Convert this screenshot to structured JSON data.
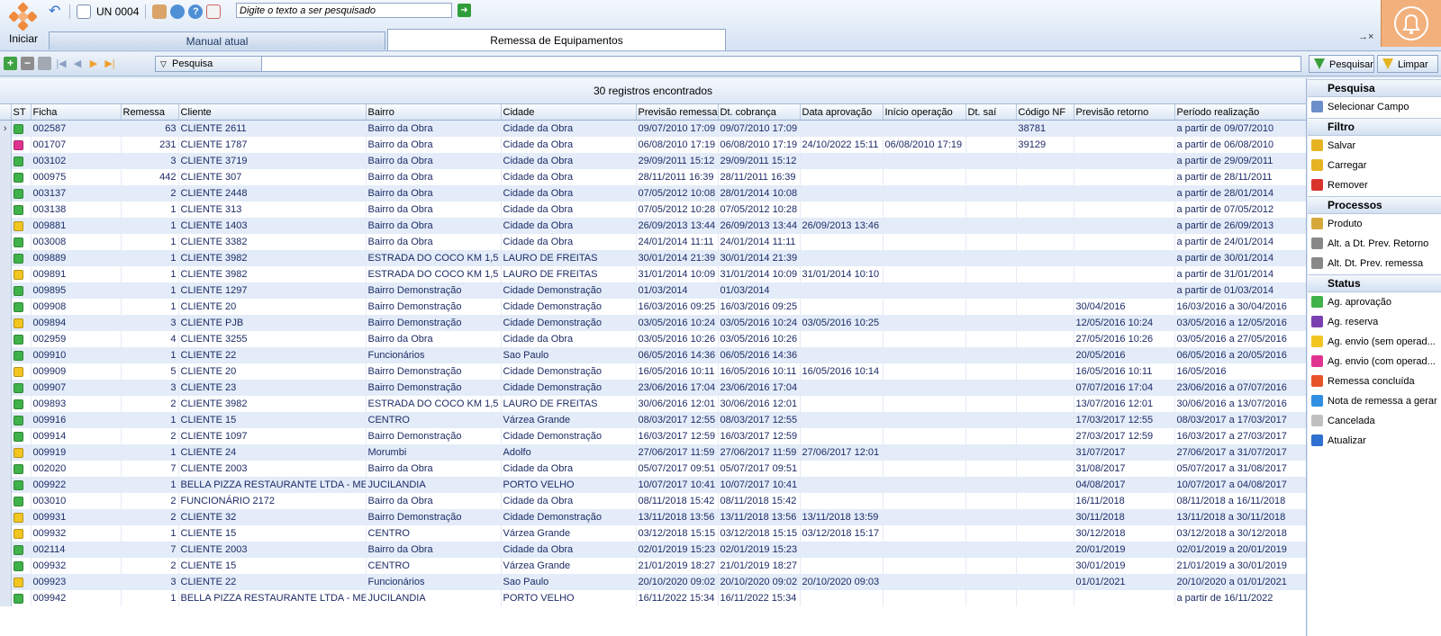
{
  "toolbar": {
    "start_label": "Iniciar",
    "unit": "UN 0004",
    "search_placeholder": "Digite o texto a ser pesquisado"
  },
  "tabs": [
    {
      "label": "Manual atual"
    },
    {
      "label": "Remessa de Equipamentos"
    }
  ],
  "tab_close": "→×",
  "filterbar": {
    "pesquisa_label": "Pesquisa",
    "search_button": "Pesquisar",
    "clear_button": "Limpar"
  },
  "grid": {
    "record_count": "30 registros encontrados",
    "columns": [
      "ST",
      "Ficha",
      "Remessa",
      "Cliente",
      "Bairro",
      "Cidade",
      "Previsão remessa",
      "Dt. cobrança",
      "Data aprovação",
      "Início operação",
      "Dt. saí",
      "Código NF",
      "Previsão retorno",
      "Período realização"
    ],
    "status_colors": {
      "green": "#3fb24a",
      "yellow": "#f2c521",
      "magenta": "#e0338f"
    },
    "rows": [
      [
        "green",
        "002587",
        "63",
        "CLIENTE  2611",
        "Bairro da Obra",
        "Cidade da Obra",
        "09/07/2010 17:09",
        "09/07/2010 17:09",
        "",
        "",
        "",
        "38781",
        "",
        "a partir de 09/07/2010"
      ],
      [
        "magenta",
        "001707",
        "231",
        "CLIENTE  1787",
        "Bairro da Obra",
        "Cidade da Obra",
        "06/08/2010 17:19",
        "06/08/2010 17:19",
        "24/10/2022 15:11",
        "06/08/2010 17:19",
        "",
        "39129",
        "",
        "a partir de 06/08/2010"
      ],
      [
        "green",
        "003102",
        "3",
        "CLIENTE  3719",
        "Bairro da Obra",
        "Cidade da Obra",
        "29/09/2011 15:12",
        "29/09/2011 15:12",
        "",
        "",
        "",
        "",
        "",
        "a partir de 29/09/2011"
      ],
      [
        "green",
        "000975",
        "442",
        "CLIENTE  307",
        "Bairro da Obra",
        "Cidade da Obra",
        "28/11/2011 16:39",
        "28/11/2011 16:39",
        "",
        "",
        "",
        "",
        "",
        "a partir de 28/11/2011"
      ],
      [
        "green",
        "003137",
        "2",
        "CLIENTE  2448",
        "Bairro da Obra",
        "Cidade da Obra",
        "07/05/2012 10:08",
        "28/01/2014 10:08",
        "",
        "",
        "",
        "",
        "",
        "a partir de 28/01/2014"
      ],
      [
        "green",
        "003138",
        "1",
        "CLIENTE  313",
        "Bairro da Obra",
        "Cidade da Obra",
        "07/05/2012 10:28",
        "07/05/2012 10:28",
        "",
        "",
        "",
        "",
        "",
        "a partir de 07/05/2012"
      ],
      [
        "yellow",
        "009881",
        "1",
        "CLIENTE  1403",
        "Bairro da Obra",
        "Cidade da Obra",
        "26/09/2013 13:44",
        "26/09/2013 13:44",
        "26/09/2013 13:46",
        "",
        "",
        "",
        "",
        "a partir de 26/09/2013"
      ],
      [
        "green",
        "003008",
        "1",
        "CLIENTE  3382",
        "Bairro da Obra",
        "Cidade da Obra",
        "24/01/2014 11:11",
        "24/01/2014 11:11",
        "",
        "",
        "",
        "",
        "",
        "a partir de 24/01/2014"
      ],
      [
        "green",
        "009889",
        "1",
        "CLIENTE 3982",
        "ESTRADA DO COCO KM 1,5",
        "LAURO DE FREITAS",
        "30/01/2014 21:39",
        "30/01/2014 21:39",
        "",
        "",
        "",
        "",
        "",
        "a partir de 30/01/2014"
      ],
      [
        "yellow",
        "009891",
        "1",
        "CLIENTE 3982",
        "ESTRADA DO COCO KM 1,5",
        "LAURO DE FREITAS",
        "31/01/2014 10:09",
        "31/01/2014 10:09",
        "31/01/2014 10:10",
        "",
        "",
        "",
        "",
        "a partir de 31/01/2014"
      ],
      [
        "green",
        "009895",
        "1",
        "CLIENTE  1297",
        "Bairro Demonstração",
        "Cidade Demonstração",
        "01/03/2014",
        "01/03/2014",
        "",
        "",
        "",
        "",
        "",
        "a partir de 01/03/2014"
      ],
      [
        "green",
        "009908",
        "1",
        "CLIENTE 20",
        "Bairro Demonstração",
        "Cidade Demonstração",
        "16/03/2016 09:25",
        "16/03/2016 09:25",
        "",
        "",
        "",
        "",
        "30/04/2016",
        "16/03/2016 a 30/04/2016"
      ],
      [
        "yellow",
        "009894",
        "3",
        "CLIENTE PJB",
        "Bairro Demonstração",
        "Cidade Demonstração",
        "03/05/2016 10:24",
        "03/05/2016 10:24",
        "03/05/2016 10:25",
        "",
        "",
        "",
        "12/05/2016 10:24",
        "03/05/2016 a 12/05/2016"
      ],
      [
        "green",
        "002959",
        "4",
        "CLIENTE  3255",
        "Bairro da Obra",
        "Cidade da Obra",
        "03/05/2016 10:26",
        "03/05/2016 10:26",
        "",
        "",
        "",
        "",
        "27/05/2016 10:26",
        "03/05/2016 a 27/05/2016"
      ],
      [
        "green",
        "009910",
        "1",
        "CLIENTE 22",
        "Funcionários",
        "Sao Paulo",
        "06/05/2016 14:36",
        "06/05/2016 14:36",
        "",
        "",
        "",
        "",
        "20/05/2016",
        "06/05/2016 a 20/05/2016"
      ],
      [
        "yellow",
        "009909",
        "5",
        "CLIENTE 20",
        "Bairro Demonstração",
        "Cidade Demonstração",
        "16/05/2016 10:11",
        "16/05/2016 10:11",
        "16/05/2016 10:14",
        "",
        "",
        "",
        "16/05/2016 10:11",
        "16/05/2016"
      ],
      [
        "green",
        "009907",
        "3",
        "CLIENTE 23",
        "Bairro Demonstração",
        "Cidade Demonstração",
        "23/06/2016 17:04",
        "23/06/2016 17:04",
        "",
        "",
        "",
        "",
        "07/07/2016 17:04",
        "23/06/2016 a 07/07/2016"
      ],
      [
        "green",
        "009893",
        "2",
        "CLIENTE 3982",
        "ESTRADA DO COCO KM 1,5",
        "LAURO DE FREITAS",
        "30/06/2016 12:01",
        "30/06/2016 12:01",
        "",
        "",
        "",
        "",
        "13/07/2016 12:01",
        "30/06/2016 a 13/07/2016"
      ],
      [
        "green",
        "009916",
        "1",
        "CLIENTE 15",
        "CENTRO",
        "Várzea Grande",
        "08/03/2017 12:55",
        "08/03/2017 12:55",
        "",
        "",
        "",
        "",
        "17/03/2017 12:55",
        "08/03/2017 a 17/03/2017"
      ],
      [
        "green",
        "009914",
        "2",
        "CLIENTE 1097",
        "Bairro Demonstração",
        "Cidade Demonstração",
        "16/03/2017 12:59",
        "16/03/2017 12:59",
        "",
        "",
        "",
        "",
        "27/03/2017 12:59",
        "16/03/2017 a 27/03/2017"
      ],
      [
        "yellow",
        "009919",
        "1",
        "CLIENTE 24",
        "Morumbi",
        "Adolfo",
        "27/06/2017 11:59",
        "27/06/2017 11:59",
        "27/06/2017 12:01",
        "",
        "",
        "",
        "31/07/2017",
        "27/06/2017 a 31/07/2017"
      ],
      [
        "green",
        "002020",
        "7",
        "CLIENTE  2003",
        "Bairro da Obra",
        "Cidade da Obra",
        "05/07/2017 09:51",
        "05/07/2017 09:51",
        "",
        "",
        "",
        "",
        "31/08/2017",
        "05/07/2017 a 31/08/2017"
      ],
      [
        "green",
        "009922",
        "1",
        "BELLA PIZZA RESTAURANTE LTDA - ME",
        "JUCILANDIA",
        "PORTO VELHO",
        "10/07/2017 10:41",
        "10/07/2017 10:41",
        "",
        "",
        "",
        "",
        "04/08/2017",
        "10/07/2017 a 04/08/2017"
      ],
      [
        "green",
        "003010",
        "2",
        "FUNCIONÁRIO  2172",
        "Bairro da Obra",
        "Cidade da Obra",
        "08/11/2018 15:42",
        "08/11/2018 15:42",
        "",
        "",
        "",
        "",
        "16/11/2018",
        "08/11/2018 a 16/11/2018"
      ],
      [
        "yellow",
        "009931",
        "2",
        "CLIENTE  32",
        "Bairro Demonstração",
        "Cidade Demonstração",
        "13/11/2018 13:56",
        "13/11/2018 13:56",
        "13/11/2018 13:59",
        "",
        "",
        "",
        "30/11/2018",
        "13/11/2018 a 30/11/2018"
      ],
      [
        "yellow",
        "009932",
        "1",
        "CLIENTE 15",
        "CENTRO",
        "Várzea Grande",
        "03/12/2018 15:15",
        "03/12/2018 15:15",
        "03/12/2018 15:17",
        "",
        "",
        "",
        "30/12/2018",
        "03/12/2018 a 30/12/2018"
      ],
      [
        "green",
        "002114",
        "7",
        "CLIENTE  2003",
        "Bairro da Obra",
        "Cidade da Obra",
        "02/01/2019 15:23",
        "02/01/2019 15:23",
        "",
        "",
        "",
        "",
        "20/01/2019",
        "02/01/2019 a 20/01/2019"
      ],
      [
        "green",
        "009932",
        "2",
        "CLIENTE 15",
        "CENTRO",
        "Várzea Grande",
        "21/01/2019 18:27",
        "21/01/2019 18:27",
        "",
        "",
        "",
        "",
        "30/01/2019",
        "21/01/2019 a 30/01/2019"
      ],
      [
        "yellow",
        "009923",
        "3",
        "CLIENTE 22",
        "Funcionários",
        "Sao Paulo",
        "20/10/2020 09:02",
        "20/10/2020 09:02",
        "20/10/2020 09:03",
        "",
        "",
        "",
        "01/01/2021",
        "20/10/2020 a 01/01/2021"
      ],
      [
        "green",
        "009942",
        "1",
        "BELLA PIZZA RESTAURANTE LTDA - ME",
        "JUCILANDIA",
        "PORTO VELHO",
        "16/11/2022 15:34",
        "16/11/2022 15:34",
        "",
        "",
        "",
        "",
        "",
        "a partir de 16/11/2022"
      ]
    ]
  },
  "sidebar": {
    "groups": [
      {
        "title": "Pesquisa",
        "items": [
          {
            "label": "Selecionar Campo",
            "icon": "field-select-icon",
            "color": "#6b8fc9"
          }
        ]
      },
      {
        "title": "Filtro",
        "items": [
          {
            "label": "Salvar",
            "icon": "filter-save-icon",
            "color": "#e6b422"
          },
          {
            "label": "Carregar",
            "icon": "filter-load-icon",
            "color": "#e6b422"
          },
          {
            "label": "Remover",
            "icon": "filter-remove-icon",
            "color": "#d9342b"
          }
        ]
      },
      {
        "title": "Processos",
        "items": [
          {
            "label": "Produto",
            "icon": "product-icon",
            "color": "#d6a93a"
          },
          {
            "label": "Alt. a Dt. Prev. Retorno",
            "icon": "document-icon",
            "color": "#888888"
          },
          {
            "label": "Alt. Dt. Prev. remessa",
            "icon": "document-icon",
            "color": "#888888"
          }
        ]
      },
      {
        "title": "Status",
        "items": [
          {
            "label": "Ag. aprovação",
            "icon": "check-green-icon",
            "color": "#3fb24a"
          },
          {
            "label": "Ag. reserva",
            "icon": "check-purple-icon",
            "color": "#7b3fb2"
          },
          {
            "label": "Ag. envio (sem operad...",
            "icon": "check-yellow-icon",
            "color": "#f2c521"
          },
          {
            "label": "Ag. envio (com operad...",
            "icon": "check-magenta-icon",
            "color": "#e0338f"
          },
          {
            "label": "Remessa concluída",
            "icon": "status-red-icon",
            "color": "#e8542a"
          },
          {
            "label": "Nota de remessa a gerar",
            "icon": "status-blue-icon",
            "color": "#2f8fe0"
          },
          {
            "label": "Cancelada",
            "icon": "status-gray-icon",
            "color": "#c0c0c0"
          },
          {
            "label": "Atualizar",
            "icon": "refresh-icon",
            "color": "#2f6fd0"
          }
        ]
      }
    ]
  }
}
